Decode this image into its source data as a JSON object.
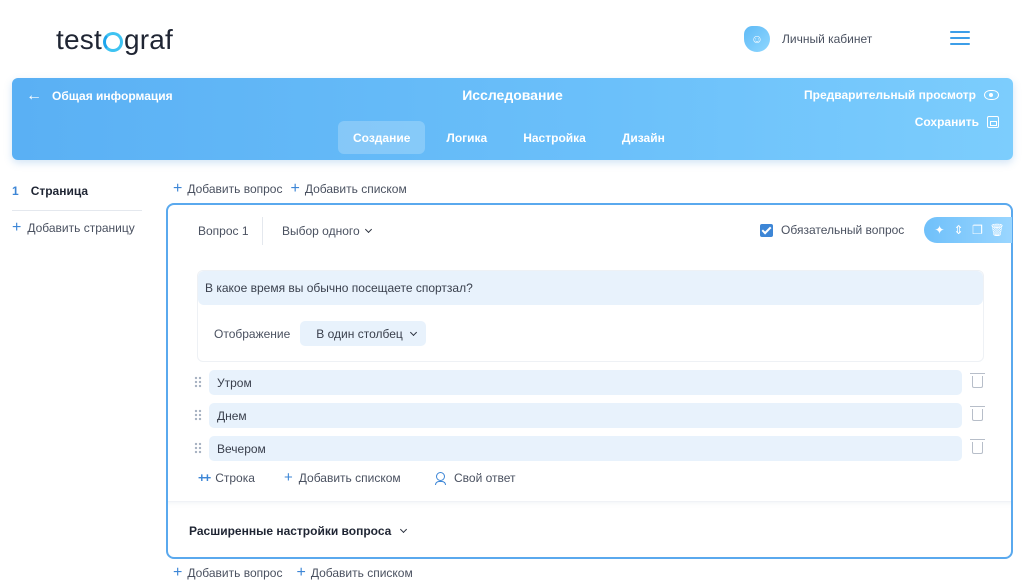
{
  "header": {
    "logo_left": "test",
    "logo_right": "graf",
    "account_label": "Личный кабинет"
  },
  "banner": {
    "back_label": "Общая информация",
    "title": "Исследование",
    "preview_label": "Предварительный просмотр",
    "save_label": "Сохранить",
    "tabs": [
      "Создание",
      "Логика",
      "Настройка",
      "Дизайн"
    ],
    "active_tab": "Создание"
  },
  "sidebar": {
    "page_number": "1",
    "page_label": "Страница",
    "add_page_label": "Добавить страницу"
  },
  "addbar": {
    "add_question": "Добавить вопрос",
    "add_list": "Добавить списком"
  },
  "question": {
    "number_label": "Вопрос 1",
    "type_label": "Выбор одного",
    "required_label": "Обязательный вопрос",
    "required_checked": true,
    "text": "В какое время вы обычно посещаете спортзал?",
    "display_label": "Отображение",
    "display_value": "В один столбец",
    "answers": [
      "Утром",
      "Днем",
      "Вечером"
    ],
    "add_row_label": "Строка",
    "add_list_label": "Добавить списком",
    "own_answer_label": "Свой ответ",
    "advanced_label": "Расширенные настройки вопроса"
  },
  "colors": {
    "accent": "#3d86d6",
    "banner_start": "#5ab0f4",
    "banner_end": "#7ccdfd",
    "field_bg": "#e8f2fc"
  }
}
